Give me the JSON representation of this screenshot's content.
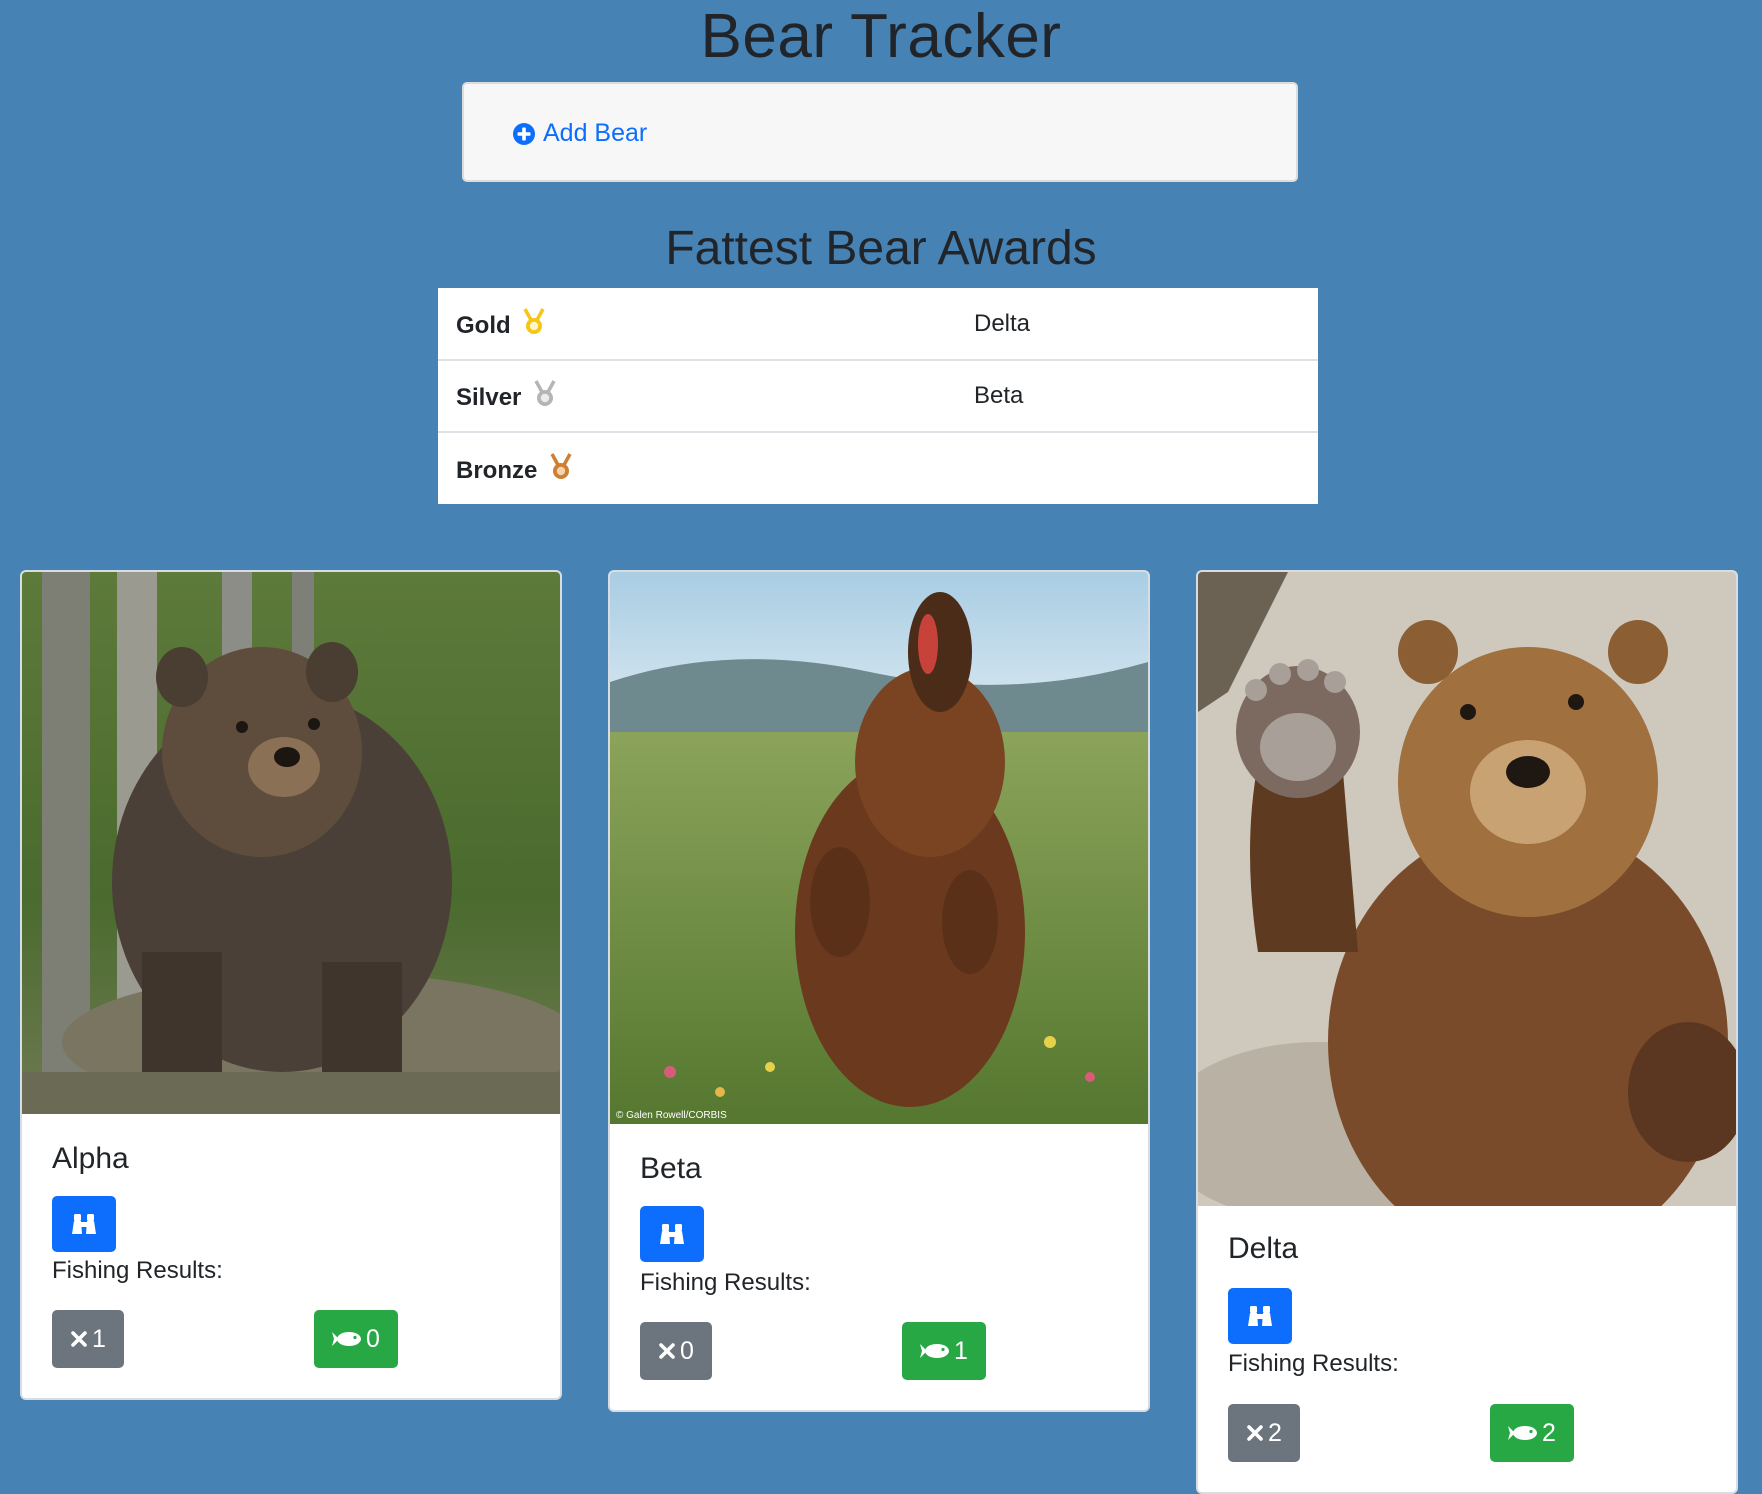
{
  "header": {
    "title": "Bear Tracker"
  },
  "add_panel": {
    "add_label": "Add Bear"
  },
  "awards": {
    "title": "Fattest Bear Awards",
    "rows": [
      {
        "place": "Gold",
        "winner": "Delta",
        "medal_color": "#f5c518"
      },
      {
        "place": "Silver",
        "winner": "Beta",
        "medal_color": "#b5b5b5"
      },
      {
        "place": "Bronze",
        "winner": "",
        "medal_color": "#cd7f32"
      }
    ]
  },
  "bears": [
    {
      "name": "Alpha",
      "fishing_label": "Fishing Results:",
      "misses": "1",
      "catches": "0"
    },
    {
      "name": "Beta",
      "fishing_label": "Fishing Results:",
      "misses": "0",
      "catches": "1",
      "photo_credit": "© Galen Rowell/CORBIS"
    },
    {
      "name": "Delta",
      "fishing_label": "Fishing Results:",
      "misses": "2",
      "catches": "2"
    }
  ],
  "icons": {
    "add": "plus-circle-icon",
    "watch": "binoculars-icon",
    "miss": "x-icon",
    "catch": "fish-icon",
    "medal": "medal-icon"
  },
  "colors": {
    "background": "#4682b4",
    "primary": "#0d6efd",
    "secondary": "#6c757d",
    "success": "#28a745"
  }
}
